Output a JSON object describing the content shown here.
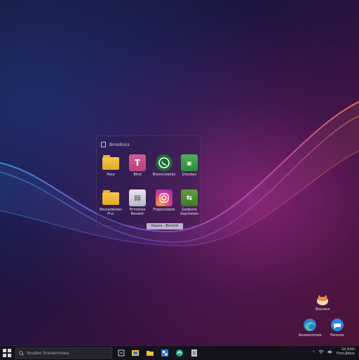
{
  "panel": {
    "header_title": "Bmsdnics",
    "apps": [
      {
        "label": "Paso",
        "icon": "folder-icon"
      },
      {
        "label": "Blird",
        "icon": "text-app-icon"
      },
      {
        "label": "Bromnsienks",
        "icon": "whatsapp-icon"
      },
      {
        "label": "Drecbes",
        "icon": "green-app-icon"
      },
      {
        "label": "Bessadeskes Plur",
        "icon": "folder-icon"
      },
      {
        "label": "Frmomse Besalor",
        "icon": "document-app-icon"
      },
      {
        "label": "Freponobate",
        "icon": "instagram-icon"
      },
      {
        "label": "Gedbore Sapmeses",
        "icon": "green-app-icon"
      }
    ],
    "tooltip": "Kaaoa - Borane"
  },
  "desktop_icons": [
    {
      "label": "Bssoacs",
      "icon": "cat-avatar-icon"
    },
    {
      "label": "Kovsesinmes",
      "icon": "edge-browser-icon"
    },
    {
      "label": "Ferones",
      "icon": "blue-chat-icon"
    }
  ],
  "taskbar": {
    "search_placeholder": "Youdoo Sreoonmees",
    "apps": [
      "task-view-icon",
      "file-explorer-icon",
      "folder-icon",
      "store-icon",
      "teams-icon",
      "notepad-icon"
    ],
    "tray_line1": "Gs bfsh",
    "tray_line2": "Foro:Jbbos"
  },
  "colors": {
    "accent_folder": "#f2bc3f",
    "accent_pink": "#e0458d",
    "accent_green": "#3fa34a",
    "taskbar_bg": "#14131c"
  }
}
